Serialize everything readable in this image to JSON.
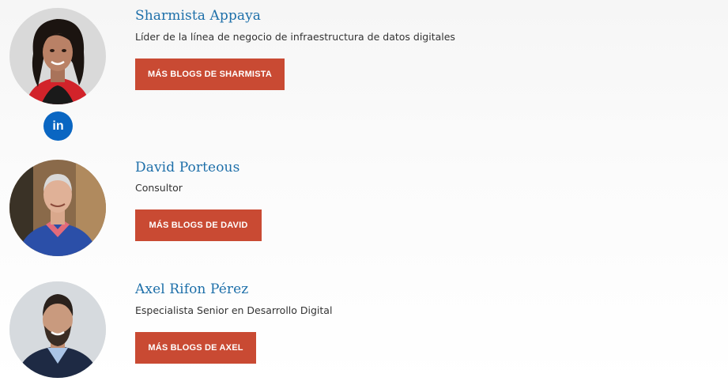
{
  "authors": [
    {
      "name": "Sharmista Appaya",
      "role": "Líder de la línea de negocio de infraestructura de datos digitales",
      "button_label": "MÁS BLOGS DE SHARMISTA",
      "social": {
        "icon": "linkedin-icon",
        "label": "in"
      }
    },
    {
      "name": "David Porteous",
      "role": "Consultor",
      "button_label": "MÁS BLOGS DE DAVID"
    },
    {
      "name": "Axel Rifon Pérez",
      "role": "Especialista Senior en Desarrollo Digital",
      "button_label": "MÁS BLOGS DE AXEL"
    }
  ],
  "colors": {
    "name_link": "#1d6fa9",
    "button_bg": "#c94a33",
    "linkedin_bg": "#0a66c2",
    "text": "#333333"
  }
}
